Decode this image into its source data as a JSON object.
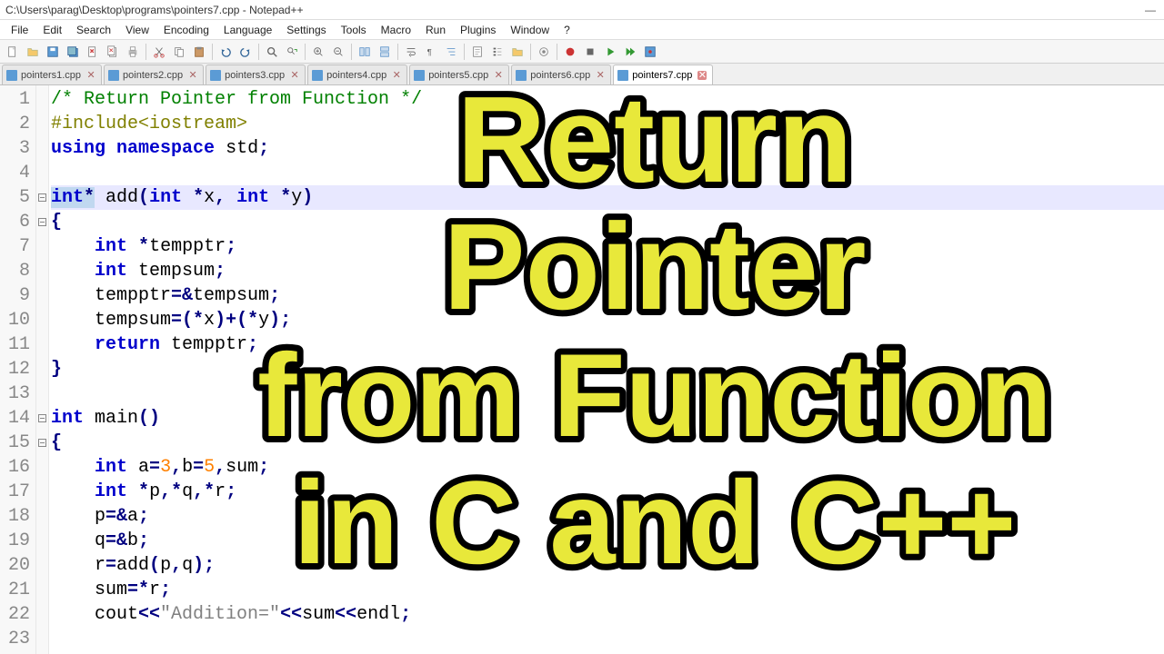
{
  "window": {
    "title": "C:\\Users\\parag\\Desktop\\programs\\pointers7.cpp - Notepad++",
    "minimize": "—",
    "close": ""
  },
  "menu": [
    "File",
    "Edit",
    "Search",
    "View",
    "Encoding",
    "Language",
    "Settings",
    "Tools",
    "Macro",
    "Run",
    "Plugins",
    "Window",
    "?"
  ],
  "tabs": [
    {
      "label": "pointers1.cpp",
      "active": false
    },
    {
      "label": "pointers2.cpp",
      "active": false
    },
    {
      "label": "pointers3.cpp",
      "active": false
    },
    {
      "label": "pointers4.cpp",
      "active": false
    },
    {
      "label": "pointers5.cpp",
      "active": false
    },
    {
      "label": "pointers6.cpp",
      "active": false
    },
    {
      "label": "pointers7.cpp",
      "active": true
    }
  ],
  "code": {
    "lines": [
      {
        "n": 1,
        "t": [
          {
            "c": "com",
            "s": "/* Return Pointer from Function */"
          }
        ]
      },
      {
        "n": 2,
        "t": [
          {
            "c": "pre",
            "s": "#include<iostream>"
          }
        ]
      },
      {
        "n": 3,
        "t": [
          {
            "c": "kw",
            "s": "using"
          },
          {
            "c": "",
            "s": " "
          },
          {
            "c": "kw",
            "s": "namespace"
          },
          {
            "c": "",
            "s": " std"
          },
          {
            "c": "op",
            "s": ";"
          }
        ]
      },
      {
        "n": 4,
        "t": []
      },
      {
        "n": 5,
        "hl": true,
        "fold": true,
        "t": [
          {
            "c": "kw sel",
            "s": "int"
          },
          {
            "c": "op sel",
            "s": "*"
          },
          {
            "c": "",
            "s": " add"
          },
          {
            "c": "op",
            "s": "("
          },
          {
            "c": "kw",
            "s": "int"
          },
          {
            "c": "",
            "s": " "
          },
          {
            "c": "op",
            "s": "*"
          },
          {
            "c": "",
            "s": "x"
          },
          {
            "c": "op",
            "s": ","
          },
          {
            "c": "",
            "s": " "
          },
          {
            "c": "kw",
            "s": "int"
          },
          {
            "c": "",
            "s": " "
          },
          {
            "c": "op",
            "s": "*"
          },
          {
            "c": "",
            "s": "y"
          },
          {
            "c": "op",
            "s": ")"
          }
        ]
      },
      {
        "n": 6,
        "fold": true,
        "t": [
          {
            "c": "op",
            "s": "{"
          }
        ]
      },
      {
        "n": 7,
        "t": [
          {
            "c": "",
            "s": "    "
          },
          {
            "c": "kw",
            "s": "int"
          },
          {
            "c": "",
            "s": " "
          },
          {
            "c": "op",
            "s": "*"
          },
          {
            "c": "",
            "s": "tempptr"
          },
          {
            "c": "op",
            "s": ";"
          }
        ]
      },
      {
        "n": 8,
        "t": [
          {
            "c": "",
            "s": "    "
          },
          {
            "c": "kw",
            "s": "int"
          },
          {
            "c": "",
            "s": " tempsum"
          },
          {
            "c": "op",
            "s": ";"
          }
        ]
      },
      {
        "n": 9,
        "t": [
          {
            "c": "",
            "s": "    tempptr"
          },
          {
            "c": "op",
            "s": "=&"
          },
          {
            "c": "",
            "s": "tempsum"
          },
          {
            "c": "op",
            "s": ";"
          }
        ]
      },
      {
        "n": 10,
        "t": [
          {
            "c": "",
            "s": "    tempsum"
          },
          {
            "c": "op",
            "s": "=(*"
          },
          {
            "c": "",
            "s": "x"
          },
          {
            "c": "op",
            "s": ")+(*"
          },
          {
            "c": "",
            "s": "y"
          },
          {
            "c": "op",
            "s": ");"
          }
        ]
      },
      {
        "n": 11,
        "t": [
          {
            "c": "",
            "s": "    "
          },
          {
            "c": "kw",
            "s": "return"
          },
          {
            "c": "",
            "s": " tempptr"
          },
          {
            "c": "op",
            "s": ";"
          }
        ]
      },
      {
        "n": 12,
        "t": [
          {
            "c": "op",
            "s": "}"
          }
        ]
      },
      {
        "n": 13,
        "t": []
      },
      {
        "n": 14,
        "fold": true,
        "t": [
          {
            "c": "kw",
            "s": "int"
          },
          {
            "c": "",
            "s": " main"
          },
          {
            "c": "op",
            "s": "()"
          }
        ]
      },
      {
        "n": 15,
        "fold": true,
        "t": [
          {
            "c": "op",
            "s": "{"
          }
        ]
      },
      {
        "n": 16,
        "t": [
          {
            "c": "",
            "s": "    "
          },
          {
            "c": "kw",
            "s": "int"
          },
          {
            "c": "",
            "s": " a"
          },
          {
            "c": "op",
            "s": "="
          },
          {
            "c": "num",
            "s": "3"
          },
          {
            "c": "op",
            "s": ","
          },
          {
            "c": "",
            "s": "b"
          },
          {
            "c": "op",
            "s": "="
          },
          {
            "c": "num",
            "s": "5"
          },
          {
            "c": "op",
            "s": ","
          },
          {
            "c": "",
            "s": "sum"
          },
          {
            "c": "op",
            "s": ";"
          }
        ]
      },
      {
        "n": 17,
        "t": [
          {
            "c": "",
            "s": "    "
          },
          {
            "c": "kw",
            "s": "int"
          },
          {
            "c": "",
            "s": " "
          },
          {
            "c": "op",
            "s": "*"
          },
          {
            "c": "",
            "s": "p"
          },
          {
            "c": "op",
            "s": ",*"
          },
          {
            "c": "",
            "s": "q"
          },
          {
            "c": "op",
            "s": ",*"
          },
          {
            "c": "",
            "s": "r"
          },
          {
            "c": "op",
            "s": ";"
          }
        ]
      },
      {
        "n": 18,
        "t": [
          {
            "c": "",
            "s": "    p"
          },
          {
            "c": "op",
            "s": "=&"
          },
          {
            "c": "",
            "s": "a"
          },
          {
            "c": "op",
            "s": ";"
          }
        ]
      },
      {
        "n": 19,
        "t": [
          {
            "c": "",
            "s": "    q"
          },
          {
            "c": "op",
            "s": "=&"
          },
          {
            "c": "",
            "s": "b"
          },
          {
            "c": "op",
            "s": ";"
          }
        ]
      },
      {
        "n": 20,
        "t": [
          {
            "c": "",
            "s": "    r"
          },
          {
            "c": "op",
            "s": "="
          },
          {
            "c": "",
            "s": "add"
          },
          {
            "c": "op",
            "s": "("
          },
          {
            "c": "",
            "s": "p"
          },
          {
            "c": "op",
            "s": ","
          },
          {
            "c": "",
            "s": "q"
          },
          {
            "c": "op",
            "s": ");"
          }
        ]
      },
      {
        "n": 21,
        "t": [
          {
            "c": "",
            "s": "    sum"
          },
          {
            "c": "op",
            "s": "=*"
          },
          {
            "c": "",
            "s": "r"
          },
          {
            "c": "op",
            "s": ";"
          }
        ]
      },
      {
        "n": 22,
        "t": [
          {
            "c": "",
            "s": "    cout"
          },
          {
            "c": "op",
            "s": "<<"
          },
          {
            "c": "str",
            "s": "\"Addition=\""
          },
          {
            "c": "op",
            "s": "<<"
          },
          {
            "c": "",
            "s": "sum"
          },
          {
            "c": "op",
            "s": "<<"
          },
          {
            "c": "",
            "s": "endl"
          },
          {
            "c": "op",
            "s": ";"
          }
        ]
      },
      {
        "n": 23,
        "t": []
      }
    ]
  },
  "overlay": {
    "l1": "Return",
    "l2": "Pointer",
    "l3": "from Function",
    "l4": "in C and C++"
  }
}
